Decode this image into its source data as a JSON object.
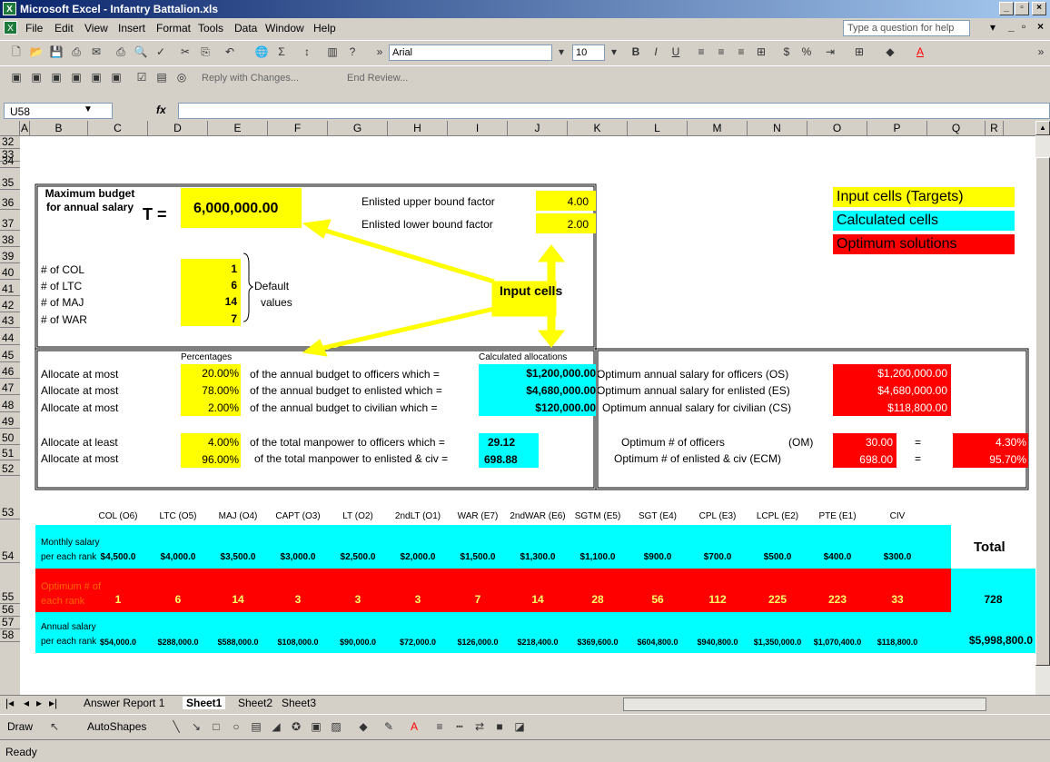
{
  "window": {
    "title": "Microsoft Excel - Infantry Battalion.xls"
  },
  "menu": {
    "items": [
      "File",
      "Edit",
      "View",
      "Insert",
      "Format",
      "Tools",
      "Data",
      "Window",
      "Help"
    ],
    "help_placeholder": "Type a question for help"
  },
  "toolbar": {
    "font": "Arial",
    "size": "10",
    "review_reply": "Reply with Changes...",
    "review_end": "End Review..."
  },
  "formula_bar": {
    "name_box": "U58",
    "fx": "fx",
    "value": ""
  },
  "columns": [
    "A",
    "B",
    "C",
    "D",
    "E",
    "F",
    "G",
    "H",
    "I",
    "J",
    "K",
    "L",
    "M",
    "N",
    "O",
    "P",
    "Q",
    "R"
  ],
  "rows": [
    "32",
    "33",
    "34",
    "35",
    "36",
    "37",
    "38",
    "39",
    "40",
    "41",
    "42",
    "43",
    "44",
    "45",
    "46",
    "47",
    "48",
    "49",
    "50",
    "51",
    "52",
    "53",
    "54",
    "55",
    "56",
    "57",
    "58"
  ],
  "sheet": {
    "max_budget_label": "Maximum budget for annual salary",
    "t_label": "T =",
    "t_value": "6,000,000.00",
    "enl_upper_label": "Enlisted upper bound factor",
    "enl_upper": "4.00",
    "enl_lower_label": "Enlisted lower bound factor",
    "enl_lower": "2.00",
    "defaults": [
      {
        "label": "# of COL",
        "value": "1"
      },
      {
        "label": "# of LTC",
        "value": "6"
      },
      {
        "label": "# of MAJ",
        "value": "14"
      },
      {
        "label": "# of WAR",
        "value": "7"
      }
    ],
    "default_note1": "Default",
    "default_note2": "values",
    "input_cells": "Input cells",
    "legend": {
      "input": "Input cells (Targets)",
      "calc": "Calculated  cells",
      "opt": "Optimum solutions"
    },
    "percentages": "Percentages",
    "calc_alloc": "Calculated allocations",
    "alloc": [
      {
        "lbl": "Allocate at most",
        "pct": "20.00%",
        "txt": "of the annual budget to officers which  =",
        "val": "$1,200,000.00",
        "opt_lbl": "Optimum annual salary for officers (OS)",
        "opt": "$1,200,000.00"
      },
      {
        "lbl": "Allocate at most",
        "pct": "78.00%",
        "txt": "of the annual budget to enlisted which =",
        "val": "$4,680,000.00",
        "opt_lbl": "Optimum annual salary for enlisted (ES)",
        "opt": "$4,680,000.00"
      },
      {
        "lbl": "Allocate at most",
        "pct": "2.00%",
        "txt": "of the annual budget to civilian which   =",
        "val": "$120,000.00",
        "opt_lbl": "Optimum annual salary for civilian (CS)",
        "opt": "$118,800.00"
      }
    ],
    "man": [
      {
        "lbl": "Allocate at least",
        "pct": "4.00%",
        "txt": "of the total manpower to officers which =",
        "val": "29.12",
        "opt_lbl": "Optimum # of officers",
        "code": "(OM)",
        "opt": "30.00",
        "eq": "=",
        "share": "4.30%"
      },
      {
        "lbl": "Allocate at most",
        "pct": "96.00%",
        "txt": "of the total manpower to enlisted & civ =",
        "val": "698.88",
        "opt_lbl": "Optimum # of enlisted & civ (ECM)",
        "code": "",
        "opt": "698.00",
        "eq": "=",
        "share": "95.70%"
      }
    ],
    "ranks": [
      "COL (O6)",
      "LTC (O5)",
      "MAJ (O4)",
      "CAPT (O3)",
      "LT (O2)",
      "2ndLT (O1)",
      "WAR (E7)",
      "2ndWAR (E6)",
      "SGTM (E5)",
      "SGT (E4)",
      "CPL (E3)",
      "LCPL (E2)",
      "PTE (E1)",
      "CIV"
    ],
    "monthly_label1": "Monthly salary",
    "monthly_label2": "per each rank",
    "monthly": [
      "$4,500.0",
      "$4,000.0",
      "$3,500.0",
      "$3,000.0",
      "$2,500.0",
      "$2,000.0",
      "$1,500.0",
      "$1,300.0",
      "$1,100.0",
      "$900.0",
      "$700.0",
      "$500.0",
      "$400.0",
      "$300.0"
    ],
    "total_label": "Total",
    "opt_label1": "Optimum # of",
    "opt_label2": "each rank",
    "optimum": [
      "1",
      "6",
      "14",
      "3",
      "3",
      "3",
      "7",
      "14",
      "28",
      "56",
      "112",
      "225",
      "223",
      "33"
    ],
    "opt_total": "728",
    "annual_label1": "Annual salary",
    "annual_label2": "per each rank",
    "annual": [
      "$54,000.0",
      "$288,000.0",
      "$588,000.0",
      "$108,000.0",
      "$90,000.0",
      "$72,000.0",
      "$126,000.0",
      "$218,400.0",
      "$369,600.0",
      "$604,800.0",
      "$940,800.0",
      "$1,350,000.0",
      "$1,070,400.0",
      "$118,800.0"
    ],
    "annual_total": "$5,998,800.0"
  },
  "tabs": [
    "Answer Report 1",
    "Sheet1",
    "Sheet2",
    "Sheet3"
  ],
  "active_tab": "Sheet1",
  "drawbar": {
    "draw": "Draw",
    "autoshapes": "AutoShapes"
  },
  "status": "Ready",
  "colors": {
    "input": "#ffff00",
    "calc": "#00ffff",
    "opt": "#ff0000"
  }
}
